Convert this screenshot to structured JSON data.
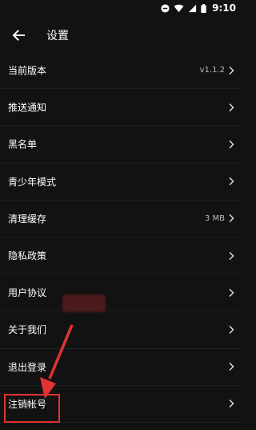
{
  "status_bar": {
    "time": "9:10",
    "icons": [
      "do-not-disturb-icon",
      "wifi-icon",
      "signal-icon",
      "battery-icon"
    ]
  },
  "header": {
    "title": "设置",
    "back_icon": "arrow-left-icon"
  },
  "settings": {
    "items": [
      {
        "label": "当前版本",
        "value": "v1.1.2"
      },
      {
        "label": "推送通知",
        "value": ""
      },
      {
        "label": "黑名单",
        "value": ""
      },
      {
        "label": "青少年模式",
        "value": ""
      },
      {
        "label": "清理缓存",
        "value": "3 MB"
      },
      {
        "label": "隐私政策",
        "value": ""
      },
      {
        "label": "用户协议",
        "value": ""
      },
      {
        "label": "关于我们",
        "value": ""
      },
      {
        "label": "退出登录",
        "value": ""
      },
      {
        "label": "注销帐号",
        "value": ""
      }
    ]
  },
  "colors": {
    "background": "#121212",
    "text": "#ffffff",
    "secondary_text": "#bdbdbd",
    "annotation": "#e23232"
  }
}
